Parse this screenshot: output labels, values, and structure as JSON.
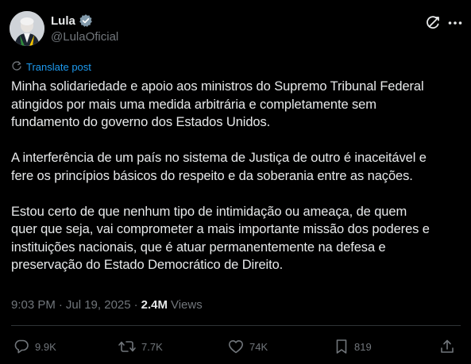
{
  "author": {
    "display_name": "Lula",
    "handle": "@LulaOficial",
    "verified": true
  },
  "header_icons": [
    "grok-icon",
    "more-icon"
  ],
  "translate": {
    "label": "Translate post"
  },
  "post": {
    "paragraphs": [
      [
        "Minha solidariedade e apoio aos ministros do Supremo Tribunal Federal",
        "atingidos por mais uma medida arbitrária e completamente sem",
        "fundamento do governo dos Estados Unidos."
      ],
      [
        "A interferência de um país no sistema de Justiça de outro é inaceitável e",
        "fere os princípios básicos do respeito e da soberania entre as nações."
      ],
      [
        "Estou certo de que nenhum tipo de intimidação ou ameaça, de quem",
        "quer que seja, vai comprometer a mais importante missão dos poderes e",
        "instituições nacionais, que é atuar permanentemente na defesa e",
        "preservação do Estado Democrático de Direito."
      ]
    ]
  },
  "meta": {
    "time": "9:03 PM",
    "separator": "·",
    "date": "Jul 19, 2025",
    "views_count": "2.4M",
    "views_label": "Views"
  },
  "actions": {
    "replies": "9.9K",
    "reposts": "7.7K",
    "likes": "74K",
    "bookmarks": "819"
  },
  "colors": {
    "background": "#000000",
    "text": "#e7e9ea",
    "muted": "#71767b",
    "accent": "#1d9bf0",
    "divider": "#2f3336"
  }
}
